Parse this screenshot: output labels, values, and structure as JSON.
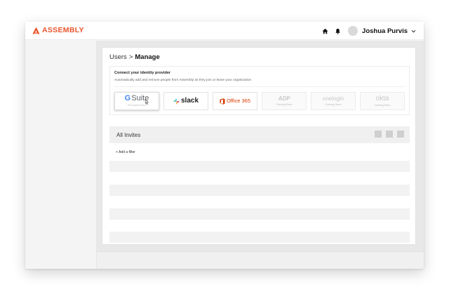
{
  "brand": {
    "name": "ASSEMBLY",
    "color": "#e8542c",
    "icon": "assembly-logo-icon"
  },
  "header": {
    "icons": [
      "home-icon",
      "bell-icon"
    ],
    "user_name": "Joshua Purvis",
    "menu_icon": "chevron-down-icon"
  },
  "breadcrumb": {
    "parent": "Users",
    "separator": ">",
    "current": "Manage"
  },
  "identity_provider": {
    "title": "Connect your identity provider",
    "description": "Automatically add and remove people from Assembly as they join or leave your organization",
    "providers": [
      {
        "name": "G Suite",
        "logo_g": "G",
        "logo_rest": "Suite",
        "subtitle": "Recommended",
        "state": "hover"
      },
      {
        "name": "slack",
        "subtitle": "",
        "state": "enabled"
      },
      {
        "name": "Office 365",
        "subtitle": "",
        "state": "enabled"
      },
      {
        "name": "ADP",
        "subtitle": "Coming Soon",
        "state": "disabled"
      },
      {
        "name": "onelogin",
        "subtitle": "Coming Soon",
        "state": "disabled"
      },
      {
        "name": "okta",
        "subtitle": "Coming Soon",
        "state": "disabled"
      }
    ]
  },
  "invites": {
    "title": "All Invites",
    "add_filter": "+ Add a filter"
  }
}
